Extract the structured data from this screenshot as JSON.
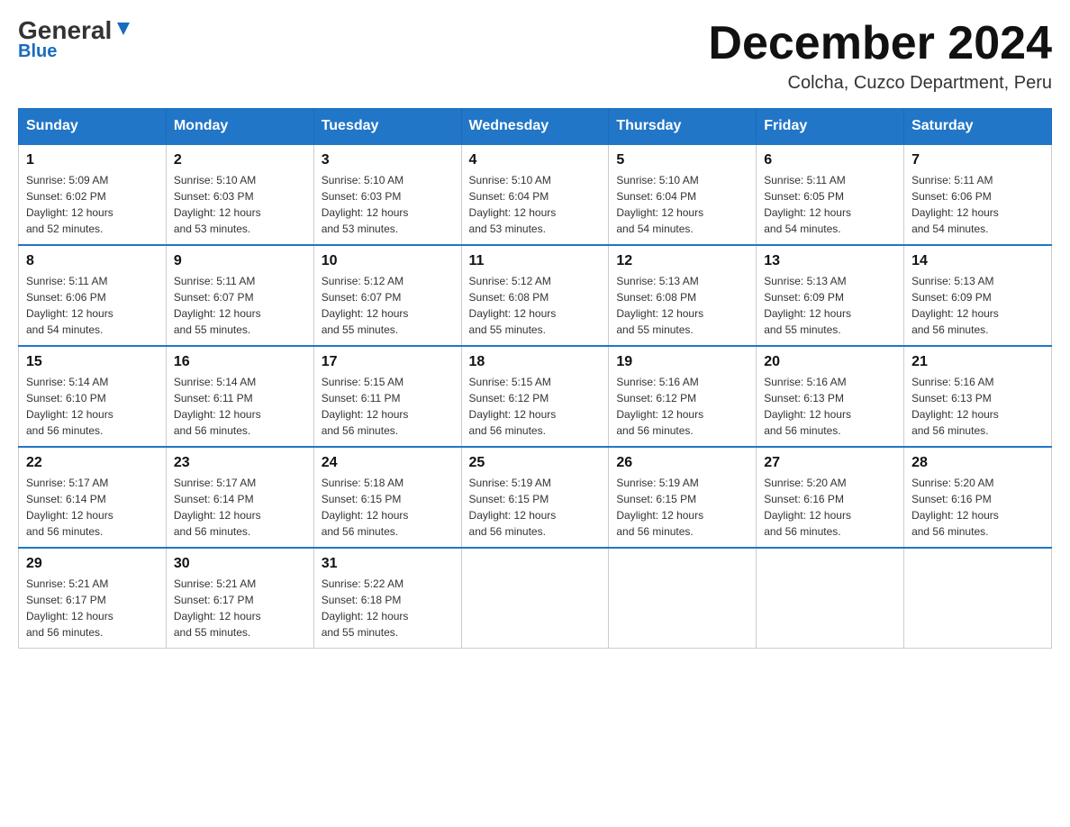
{
  "header": {
    "logo_general": "General",
    "logo_blue": "Blue",
    "title": "December 2024",
    "location": "Colcha, Cuzco Department, Peru"
  },
  "days_of_week": [
    "Sunday",
    "Monday",
    "Tuesday",
    "Wednesday",
    "Thursday",
    "Friday",
    "Saturday"
  ],
  "weeks": [
    [
      {
        "day": "1",
        "sunrise": "5:09 AM",
        "sunset": "6:02 PM",
        "daylight": "12 hours and 52 minutes."
      },
      {
        "day": "2",
        "sunrise": "5:10 AM",
        "sunset": "6:03 PM",
        "daylight": "12 hours and 53 minutes."
      },
      {
        "day": "3",
        "sunrise": "5:10 AM",
        "sunset": "6:03 PM",
        "daylight": "12 hours and 53 minutes."
      },
      {
        "day": "4",
        "sunrise": "5:10 AM",
        "sunset": "6:04 PM",
        "daylight": "12 hours and 53 minutes."
      },
      {
        "day": "5",
        "sunrise": "5:10 AM",
        "sunset": "6:04 PM",
        "daylight": "12 hours and 54 minutes."
      },
      {
        "day": "6",
        "sunrise": "5:11 AM",
        "sunset": "6:05 PM",
        "daylight": "12 hours and 54 minutes."
      },
      {
        "day": "7",
        "sunrise": "5:11 AM",
        "sunset": "6:06 PM",
        "daylight": "12 hours and 54 minutes."
      }
    ],
    [
      {
        "day": "8",
        "sunrise": "5:11 AM",
        "sunset": "6:06 PM",
        "daylight": "12 hours and 54 minutes."
      },
      {
        "day": "9",
        "sunrise": "5:11 AM",
        "sunset": "6:07 PM",
        "daylight": "12 hours and 55 minutes."
      },
      {
        "day": "10",
        "sunrise": "5:12 AM",
        "sunset": "6:07 PM",
        "daylight": "12 hours and 55 minutes."
      },
      {
        "day": "11",
        "sunrise": "5:12 AM",
        "sunset": "6:08 PM",
        "daylight": "12 hours and 55 minutes."
      },
      {
        "day": "12",
        "sunrise": "5:13 AM",
        "sunset": "6:08 PM",
        "daylight": "12 hours and 55 minutes."
      },
      {
        "day": "13",
        "sunrise": "5:13 AM",
        "sunset": "6:09 PM",
        "daylight": "12 hours and 55 minutes."
      },
      {
        "day": "14",
        "sunrise": "5:13 AM",
        "sunset": "6:09 PM",
        "daylight": "12 hours and 56 minutes."
      }
    ],
    [
      {
        "day": "15",
        "sunrise": "5:14 AM",
        "sunset": "6:10 PM",
        "daylight": "12 hours and 56 minutes."
      },
      {
        "day": "16",
        "sunrise": "5:14 AM",
        "sunset": "6:11 PM",
        "daylight": "12 hours and 56 minutes."
      },
      {
        "day": "17",
        "sunrise": "5:15 AM",
        "sunset": "6:11 PM",
        "daylight": "12 hours and 56 minutes."
      },
      {
        "day": "18",
        "sunrise": "5:15 AM",
        "sunset": "6:12 PM",
        "daylight": "12 hours and 56 minutes."
      },
      {
        "day": "19",
        "sunrise": "5:16 AM",
        "sunset": "6:12 PM",
        "daylight": "12 hours and 56 minutes."
      },
      {
        "day": "20",
        "sunrise": "5:16 AM",
        "sunset": "6:13 PM",
        "daylight": "12 hours and 56 minutes."
      },
      {
        "day": "21",
        "sunrise": "5:16 AM",
        "sunset": "6:13 PM",
        "daylight": "12 hours and 56 minutes."
      }
    ],
    [
      {
        "day": "22",
        "sunrise": "5:17 AM",
        "sunset": "6:14 PM",
        "daylight": "12 hours and 56 minutes."
      },
      {
        "day": "23",
        "sunrise": "5:17 AM",
        "sunset": "6:14 PM",
        "daylight": "12 hours and 56 minutes."
      },
      {
        "day": "24",
        "sunrise": "5:18 AM",
        "sunset": "6:15 PM",
        "daylight": "12 hours and 56 minutes."
      },
      {
        "day": "25",
        "sunrise": "5:19 AM",
        "sunset": "6:15 PM",
        "daylight": "12 hours and 56 minutes."
      },
      {
        "day": "26",
        "sunrise": "5:19 AM",
        "sunset": "6:15 PM",
        "daylight": "12 hours and 56 minutes."
      },
      {
        "day": "27",
        "sunrise": "5:20 AM",
        "sunset": "6:16 PM",
        "daylight": "12 hours and 56 minutes."
      },
      {
        "day": "28",
        "sunrise": "5:20 AM",
        "sunset": "6:16 PM",
        "daylight": "12 hours and 56 minutes."
      }
    ],
    [
      {
        "day": "29",
        "sunrise": "5:21 AM",
        "sunset": "6:17 PM",
        "daylight": "12 hours and 56 minutes."
      },
      {
        "day": "30",
        "sunrise": "5:21 AM",
        "sunset": "6:17 PM",
        "daylight": "12 hours and 55 minutes."
      },
      {
        "day": "31",
        "sunrise": "5:22 AM",
        "sunset": "6:18 PM",
        "daylight": "12 hours and 55 minutes."
      },
      null,
      null,
      null,
      null
    ]
  ],
  "labels": {
    "sunrise": "Sunrise:",
    "sunset": "Sunset:",
    "daylight": "Daylight:"
  }
}
